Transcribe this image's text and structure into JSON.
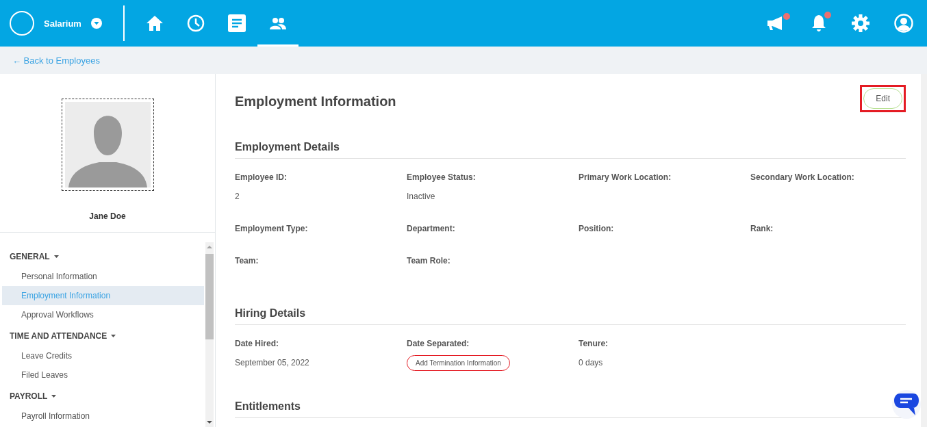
{
  "header": {
    "brand": "Salarium",
    "nav": [
      {
        "kind": "home",
        "selected": false
      },
      {
        "kind": "clock",
        "selected": false
      },
      {
        "kind": "document",
        "selected": false
      },
      {
        "kind": "people",
        "selected": true
      }
    ],
    "actions": [
      {
        "kind": "megaphone",
        "badge": true
      },
      {
        "kind": "bell",
        "badge": true
      },
      {
        "kind": "gear",
        "badge": false
      },
      {
        "kind": "user",
        "badge": false
      }
    ]
  },
  "back_link": "← Back to Employees",
  "profile": {
    "name": "Jane Doe"
  },
  "sidebar": {
    "sections": [
      {
        "title": "GENERAL",
        "expanded": true,
        "items": [
          {
            "label": "Personal Information",
            "selected": false
          },
          {
            "label": "Employment Information",
            "selected": true
          },
          {
            "label": "Approval Workflows",
            "selected": false
          }
        ]
      },
      {
        "title": "TIME AND ATTENDANCE",
        "expanded": true,
        "items": [
          {
            "label": "Leave Credits",
            "selected": false
          },
          {
            "label": "Filed Leaves",
            "selected": false
          }
        ]
      },
      {
        "title": "PAYROLL",
        "expanded": true,
        "items": [
          {
            "label": "Payroll Information",
            "selected": false
          }
        ]
      }
    ]
  },
  "content": {
    "title": "Employment Information",
    "edit_button": "Edit",
    "sections": [
      {
        "title": "Employment Details",
        "fields": [
          {
            "label": "Employee ID:",
            "kind": "text",
            "value": "2"
          },
          {
            "label": "Employee Status:",
            "kind": "text",
            "value": "Inactive"
          },
          {
            "label": "Primary Work Location:",
            "kind": "text"
          },
          {
            "label": "Secondary Work Location:",
            "kind": "text"
          },
          {
            "label": "Employment Type:",
            "kind": "text"
          },
          {
            "label": "Department:",
            "kind": "text"
          },
          {
            "label": "Position:",
            "kind": "text"
          },
          {
            "label": "Rank:",
            "kind": "text"
          },
          {
            "label": "Team:",
            "kind": "text"
          },
          {
            "label": "Team Role:",
            "kind": "text"
          }
        ]
      },
      {
        "title": "Hiring Details",
        "fields": [
          {
            "label": "Date Hired:",
            "kind": "text",
            "value": "September 05, 2022"
          },
          {
            "label": "Date Separated:",
            "kind": "button",
            "value": "Add Termination Information"
          },
          {
            "label": "Tenure:",
            "kind": "text",
            "value": "0 days"
          }
        ]
      },
      {
        "title": "Entitlements"
      }
    ]
  }
}
